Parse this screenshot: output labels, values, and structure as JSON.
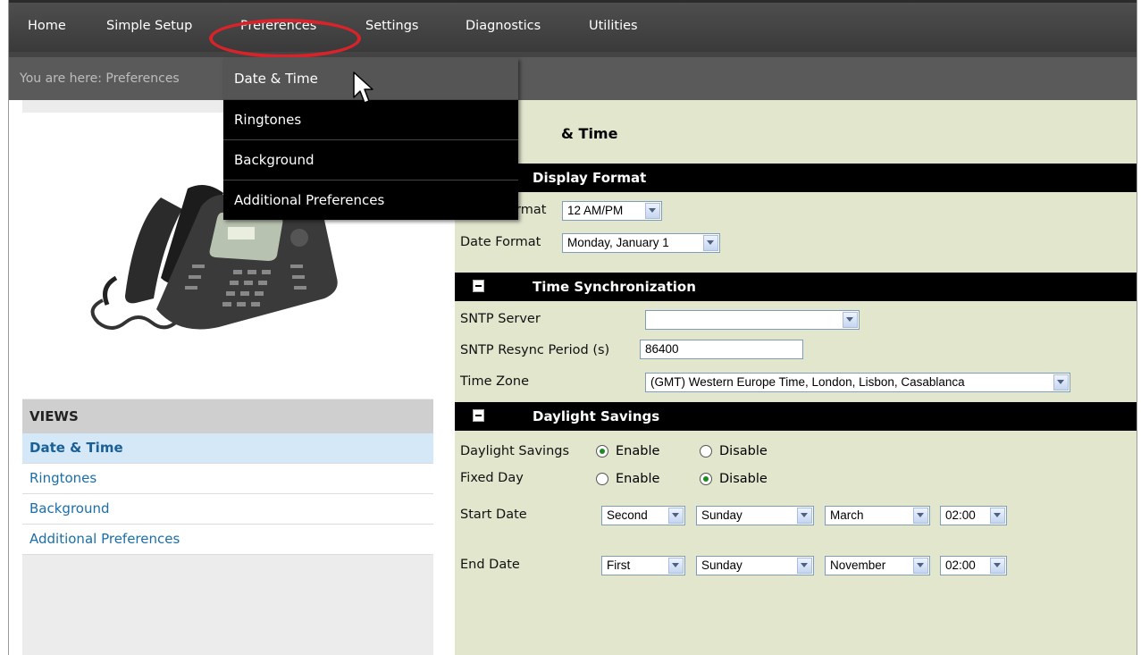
{
  "nav": {
    "items": [
      "Home",
      "Simple Setup",
      "Preferences",
      "Settings",
      "Diagnostics",
      "Utilities"
    ]
  },
  "breadcrumb": "You are here: Preferences",
  "dropdown": {
    "items": [
      "Date & Time",
      "Ringtones",
      "Background",
      "Additional Preferences"
    ]
  },
  "sidebar": {
    "heading": "VIEWS",
    "items": [
      "Date & Time",
      "Ringtones",
      "Background",
      "Additional Preferences"
    ],
    "selected": "Date & Time"
  },
  "main": {
    "page_title": "& Time",
    "display_format": {
      "heading": "Display Format",
      "time_format_label": "rmat",
      "time_format_value": "12 AM/PM",
      "date_format_label": "Date Format",
      "date_format_value": "Monday, January 1"
    },
    "time_sync": {
      "heading": "Time Synchronization",
      "sntp_server_label": "SNTP Server",
      "sntp_server_value": "",
      "resync_label": "SNTP Resync Period (s)",
      "resync_value": "86400",
      "timezone_label": "Time Zone",
      "timezone_value": "(GMT) Western Europe Time, London, Lisbon, Casablanca"
    },
    "daylight": {
      "heading": "Daylight Savings",
      "ds_label": "Daylight Savings",
      "fixed_label": "Fixed Day",
      "enable": "Enable",
      "disable": "Disable",
      "start_label": "Start Date",
      "end_label": "End Date",
      "start": {
        "week": "Second",
        "day": "Sunday",
        "month": "March",
        "time": "02:00"
      },
      "end": {
        "week": "First",
        "day": "Sunday",
        "month": "November",
        "time": "02:00"
      }
    }
  },
  "colors": {
    "accent_ring": "#d9232b",
    "link": "#1a6fa8",
    "main_bg": "#e2e6cd",
    "radio_dot": "#1f8a1f"
  }
}
